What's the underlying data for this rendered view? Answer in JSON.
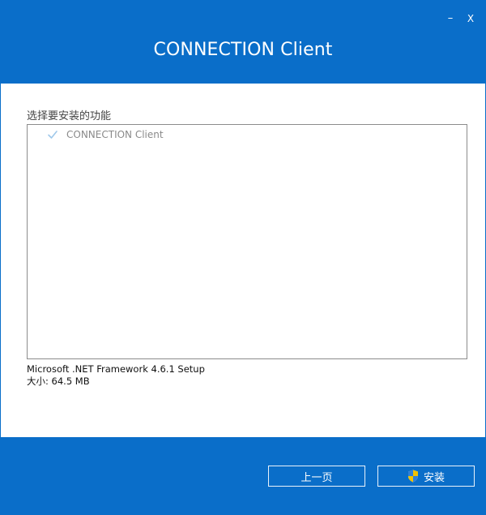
{
  "window": {
    "title": "CONNECTION Client",
    "minimize_label": "–",
    "close_label": "X"
  },
  "features": {
    "section_label": "选择要安装的功能",
    "items": [
      {
        "label": "CONNECTION Client",
        "checked": true,
        "icon": "checkmark-icon"
      }
    ]
  },
  "info": {
    "setup_name": "Microsoft .NET Framework 4.6.1 Setup",
    "size_text": "大小: 64.5 MB"
  },
  "footer": {
    "back_label": "上一页",
    "install_label": "安装",
    "install_icon": "uac-shield-icon"
  },
  "colors": {
    "accent": "#0a6ec9",
    "check": "#9fc8ea"
  }
}
